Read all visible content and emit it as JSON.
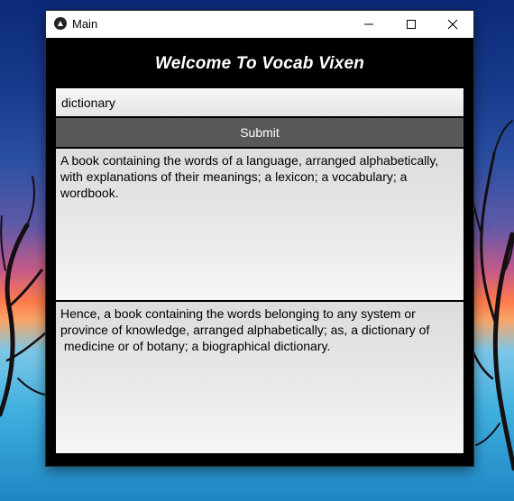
{
  "window": {
    "title": "Main",
    "app_icon": "kivy-icon",
    "controls": [
      "minimize-icon",
      "maximize-icon",
      "close-icon"
    ]
  },
  "app": {
    "heading": "Welcome To Vocab Vixen",
    "search_value": "dictionary",
    "submit_label": "Submit",
    "definitions": [
      "A book containing the words of a language, arranged alphabetically, with explanations of their meanings; a lexicon; a vocabulary; a wordbook.",
      "Hence, a book containing the words belonging to any system or province of knowledge, arranged alphabetically; as, a dictionary of\n medicine or of botany; a biographical dictionary."
    ]
  },
  "colors": {
    "window_background": "#000000",
    "title_bar": "#ffffff",
    "heading_text": "#ffffff",
    "button_background": "#585858",
    "button_text": "#ffffff",
    "field_background": "#e9e9e9"
  }
}
